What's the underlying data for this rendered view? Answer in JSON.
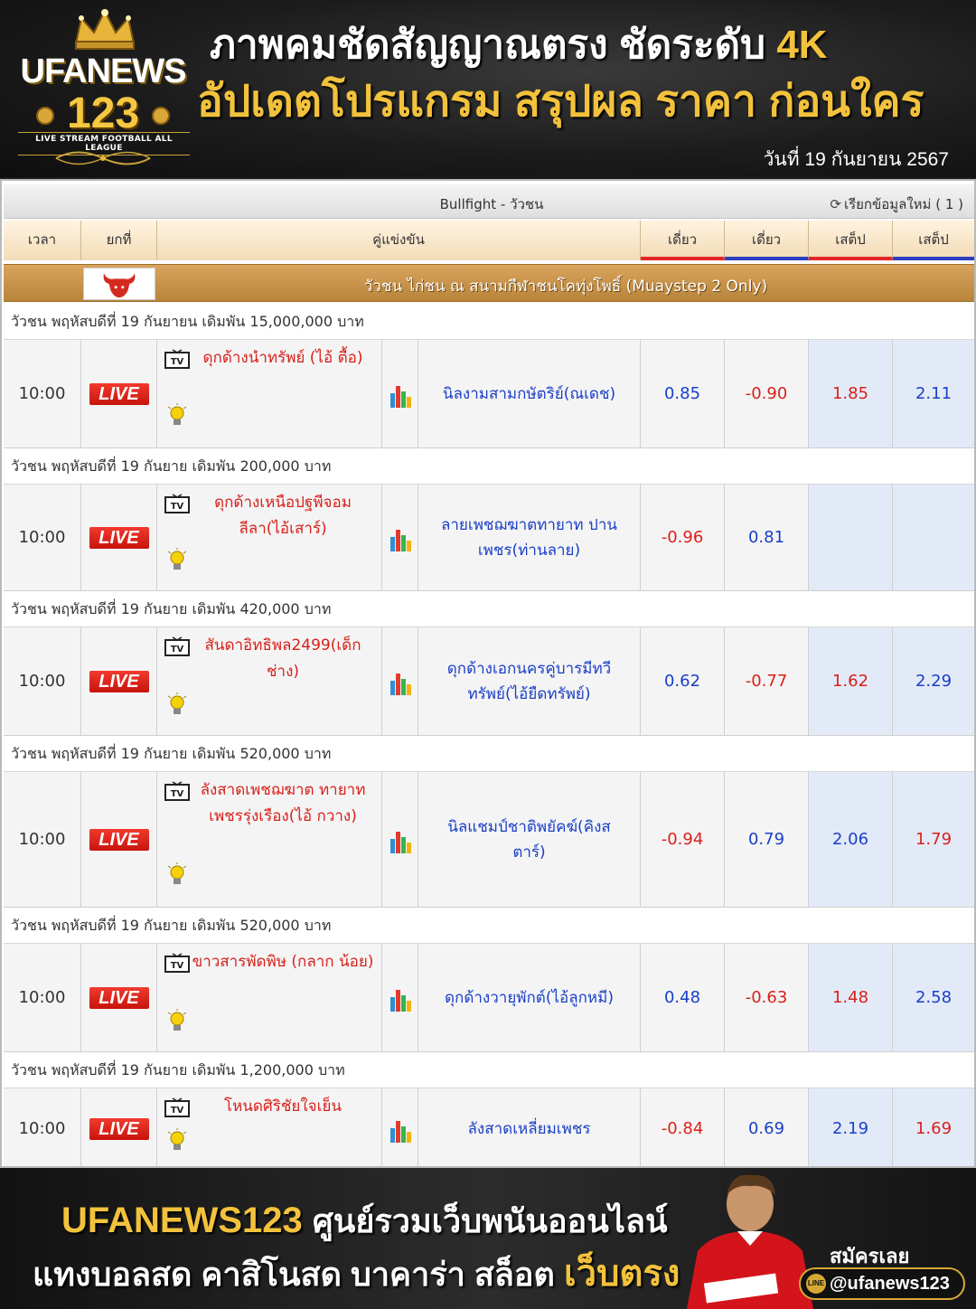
{
  "header": {
    "logo_brand": "UFANEWS",
    "logo_number": "123",
    "logo_tagline": "LIVE STREAM FOOTBALL ALL LEAGUE",
    "headline1_main": "ภาพคมชัดสัญญาณตรง ชัดระดับ ",
    "headline1_accent": "4K",
    "headline2": "อัปเดตโปรแกรม สรุปผล ราคา ก่อนใคร",
    "date": "วันที่ 19 กันยายน 2567"
  },
  "board": {
    "title": "Bullfight - วัวชน",
    "refresh_label": "เรียกข้อมูลใหม่ ( 1 )",
    "columns": [
      "เวลา",
      "ยกที่",
      "คู่แข่งขัน",
      "เดี่ยว",
      "เดี่ยว",
      "เสต็ป",
      "เสต็ป"
    ],
    "league_name": "วัวชน ไก่ชน ณ สนามกีฬาชนโคทุ่งโพธิ์ (Muaystep 2 Only)",
    "live_label": "LIVE",
    "matches": [
      {
        "desc": "วัวชน พฤหัสบดีที่ 19 กันยายน เดิมพัน 15,000,000 บาท",
        "time": "10:00",
        "home": "ดุกด้างนำทรัพย์ (ไอ้ ตื้อ)",
        "away": "นิลงามสามกษัตริย์(ณเดช)",
        "o1": "0.85",
        "o2": "-0.90",
        "o3": "1.85",
        "o4": "2.11"
      },
      {
        "desc": "วัวชน พฤหัสบดีที่ 19 กันยาย เดิมพัน 200,000 บาท",
        "time": "10:00",
        "home": "ดุกด้างเหนือปฐพีจอม ลีลา(ไอ้เสาร์)",
        "away": "ลายเพชฌฆาตทายาท ปานเพชร(ท่านลาย)",
        "o1": "-0.96",
        "o2": "0.81",
        "o3": "",
        "o4": ""
      },
      {
        "desc": "วัวชน พฤหัสบดีที่ 19 กันยาย เดิมพัน 420,000 บาท",
        "time": "10:00",
        "home": "สันดาอิทธิพล2499(เด็ก ช่าง)",
        "away": "ดุกด้างเอกนครคู่บารมีทวี ทรัพย์(ไอ้ยืดทรัพย์)",
        "o1": "0.62",
        "o2": "-0.77",
        "o3": "1.62",
        "o4": "2.29"
      },
      {
        "desc": "วัวชน พฤหัสบดีที่ 19 กันยาย เดิมพัน 520,000 บาท",
        "time": "10:00",
        "home": "ลังสาดเพชฌฆาต ทายาทเพชรรุ่งเรือง(ไอ้ กวาง)",
        "away": "นิลแชมป์ชาติพยัคฆ์(คิงส ตาร์)",
        "o1": "-0.94",
        "o2": "0.79",
        "o3": "2.06",
        "o4": "1.79"
      },
      {
        "desc": "วัวชน พฤหัสบดีที่ 19 กันยาย เดิมพัน 520,000 บาท",
        "time": "10:00",
        "home": "ขาวสารพัดพิษ (กลาก น้อย)",
        "away": "ดุกด้างวายุพักต์(ไอ้ลูกหมี)",
        "o1": "0.48",
        "o2": "-0.63",
        "o3": "1.48",
        "o4": "2.58"
      },
      {
        "desc": "วัวชน พฤหัสบดีที่ 19 กันยาย เดิมพัน 1,200,000 บาท",
        "time": "10:00",
        "home": "โหนดศิริชัยใจเย็น",
        "away": "ลังสาดเหลี่ยมเพชร",
        "o1": "-0.84",
        "o2": "0.69",
        "o3": "2.19",
        "o4": "1.69"
      }
    ]
  },
  "footer": {
    "brand": "UFANEWS123",
    "tagline1": "ศูนย์รวมเว็บพนันออนไลน์",
    "tagline2": "แทงบอลสด คาสิโนสด บาคาร่า สล็อต",
    "tagline2_accent": "เว็บตรง",
    "join": "สมัครเลย",
    "handle": "@ufanews123",
    "handle_icon": "LINE"
  },
  "colors": {
    "odds_positive": "#1a3fc8",
    "odds_negative": "#d8211b",
    "accent_gold": "#f3c23c",
    "league_bar": "#c8924a",
    "live_badge": "#d8211b"
  },
  "icons": [
    "tv-icon",
    "lightbulb-icon",
    "stats-bars-icon",
    "bull-icon",
    "refresh-icon",
    "crown-icon"
  ]
}
